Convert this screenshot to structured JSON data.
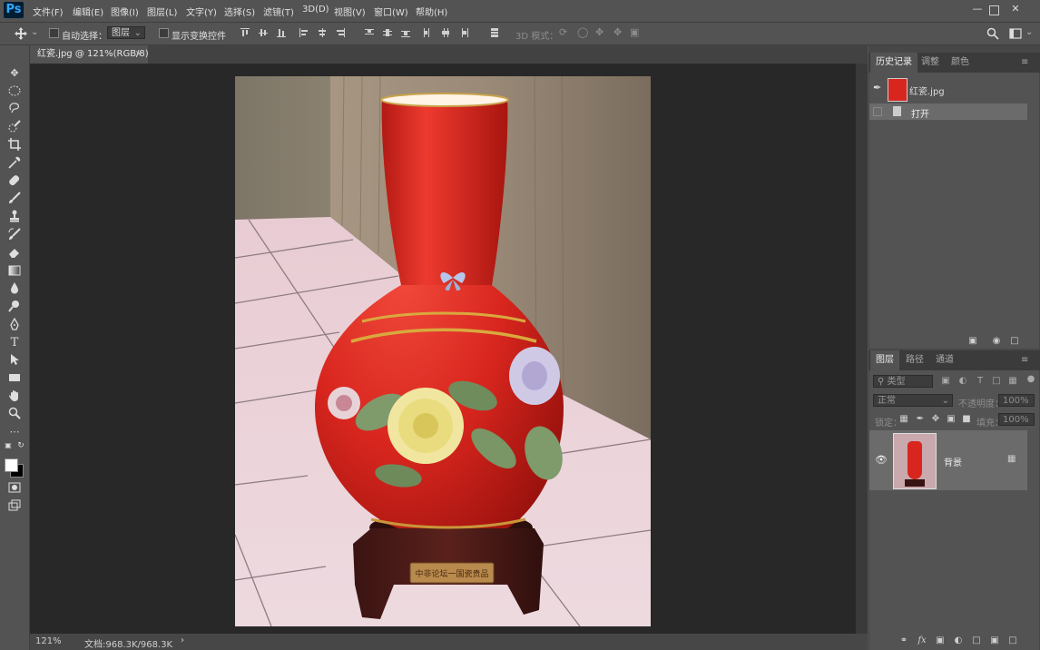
{
  "app": {
    "logo": "Ps"
  },
  "menu": [
    "文件(F)",
    "编辑(E)",
    "图像(I)",
    "图层(L)",
    "文字(Y)",
    "选择(S)",
    "滤镜(T)",
    "3D(D)",
    "视图(V)",
    "窗口(W)",
    "帮助(H)"
  ],
  "options_bar": {
    "auto_select_label": "自动选择：",
    "auto_select_value": "图层",
    "show_transform_label": "显示变换控件",
    "mode_3d_label": "3D 模式："
  },
  "document": {
    "tab_title": "红瓷.jpg @ 121%(RGB/8)",
    "zoom": "121%",
    "doc_size": "文档:968.3K/968.3K"
  },
  "history_panel": {
    "tabs": [
      "历史记录",
      "调整",
      "颜色"
    ],
    "snapshot_name": "红瓷.jpg",
    "steps": [
      "打开"
    ]
  },
  "layers_panel": {
    "tabs": [
      "图层",
      "路径",
      "通道"
    ],
    "kind_filter": "类型",
    "blend_mode": "正常",
    "opacity_label": "不透明度：",
    "opacity_value": "100%",
    "lock_label": "锁定：",
    "fill_label": "填充：",
    "fill_value": "100%",
    "layers": [
      {
        "name": "背景",
        "visible": true,
        "locked": true
      }
    ]
  },
  "colors": {
    "vase_red": "#d8261e",
    "accent_blue": "#31a8ff"
  }
}
